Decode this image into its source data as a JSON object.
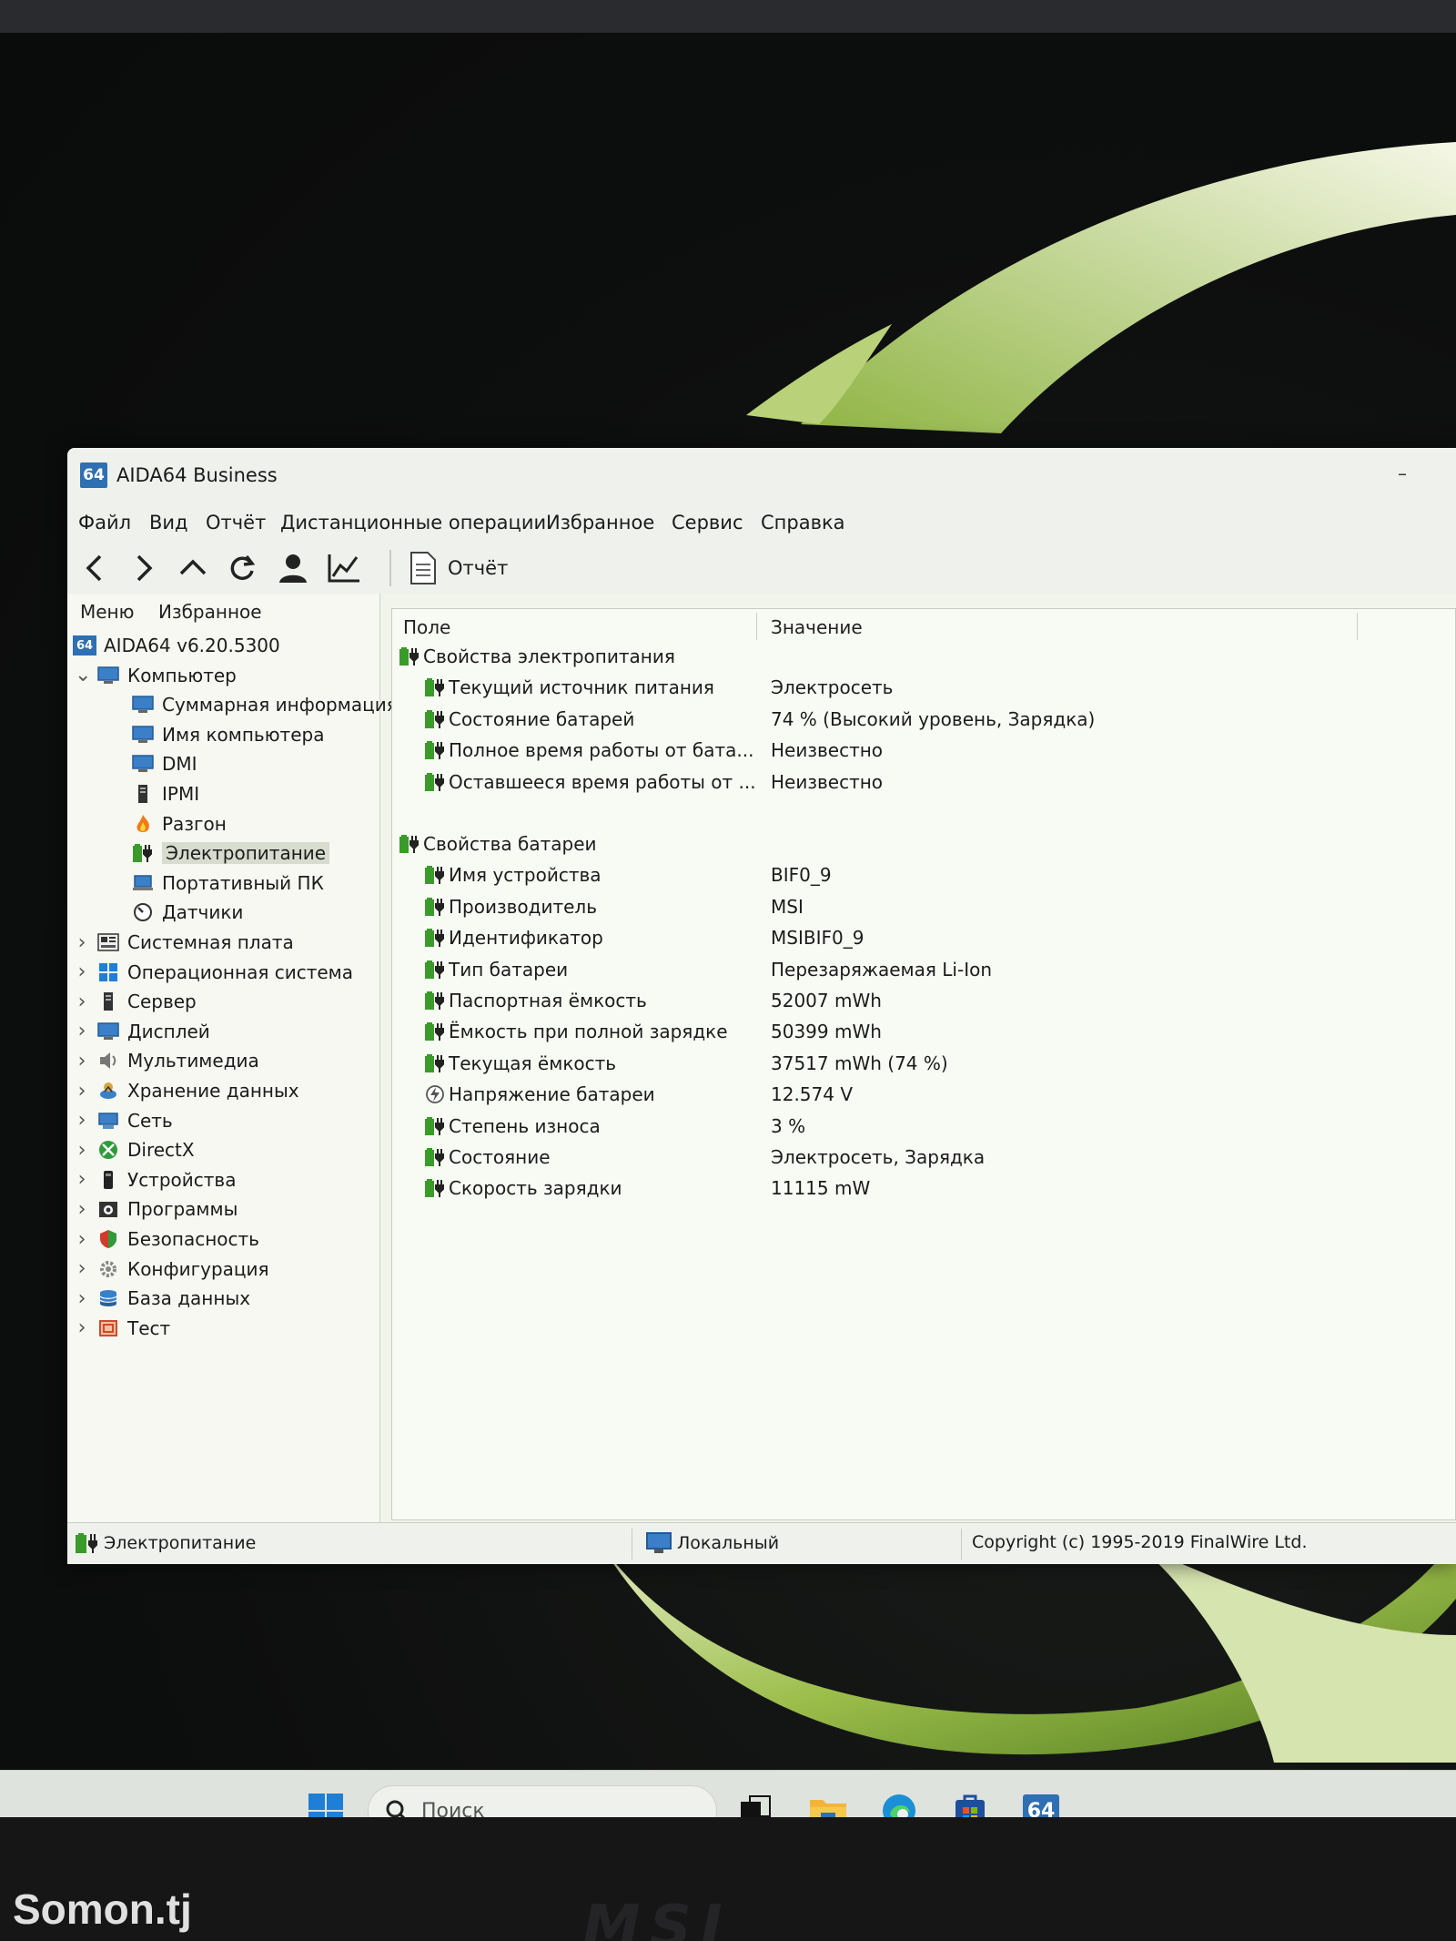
{
  "window": {
    "icon_text": "64",
    "title": "AIDA64 Business"
  },
  "menu": [
    "Файл",
    "Вид",
    "Отчёт",
    "Дистанционные операции",
    "Избранное",
    "Сервис",
    "Справка"
  ],
  "toolbar": {
    "report_label": "Отчёт"
  },
  "left_tabs": [
    "Меню",
    "Избранное"
  ],
  "tree": [
    {
      "label": "AIDA64 v6.20.5300",
      "icon": "aida64-icon"
    },
    {
      "label": "Компьютер",
      "icon": "computer-icon"
    },
    {
      "label": "Суммарная информация",
      "icon": "monitor-icon"
    },
    {
      "label": "Имя компьютера",
      "icon": "monitor-icon"
    },
    {
      "label": "DMI",
      "icon": "monitor-icon"
    },
    {
      "label": "IPMI",
      "icon": "server-icon"
    },
    {
      "label": "Разгон",
      "icon": "flame-icon"
    },
    {
      "label": "Электропитание",
      "icon": "battery-icon"
    },
    {
      "label": "Портативный ПК",
      "icon": "laptop-icon"
    },
    {
      "label": "Датчики",
      "icon": "gauge-icon"
    },
    {
      "label": "Системная плата",
      "icon": "motherboard-icon"
    },
    {
      "label": "Операционная система",
      "icon": "windows-icon"
    },
    {
      "label": "Сервер",
      "icon": "server-icon"
    },
    {
      "label": "Дисплей",
      "icon": "monitor-icon"
    },
    {
      "label": "Мультимедиа",
      "icon": "speaker-icon"
    },
    {
      "label": "Хранение данных",
      "icon": "storage-icon"
    },
    {
      "label": "Сеть",
      "icon": "network-icon"
    },
    {
      "label": "DirectX",
      "icon": "xbox-icon"
    },
    {
      "label": "Устройства",
      "icon": "device-icon"
    },
    {
      "label": "Программы",
      "icon": "programs-icon"
    },
    {
      "label": "Безопасность",
      "icon": "shield-icon"
    },
    {
      "label": "Конфигурация",
      "icon": "config-icon"
    },
    {
      "label": "База данных",
      "icon": "database-icon"
    },
    {
      "label": "Тест",
      "icon": "test-icon"
    }
  ],
  "table": {
    "col_field": "Поле",
    "col_value": "Значение",
    "rows": [
      {
        "field": "Свойства электропитания",
        "value": "",
        "group": true
      },
      {
        "field": "Текущий источник питания",
        "value": "Электросеть"
      },
      {
        "field": "Состояние батарей",
        "value": "74 % (Высокий уровень, Зарядка)"
      },
      {
        "field": "Полное время работы от бата...",
        "value": "Неизвестно"
      },
      {
        "field": "Оставшееся время работы от ...",
        "value": "Неизвестно"
      },
      {
        "field": "Свойства батареи",
        "value": "",
        "group": true
      },
      {
        "field": "Имя устройства",
        "value": "BIF0_9"
      },
      {
        "field": "Производитель",
        "value": "MSI"
      },
      {
        "field": "Идентификатор",
        "value": "MSIBIF0_9"
      },
      {
        "field": "Тип батареи",
        "value": "Перезаряжаемая Li-Ion"
      },
      {
        "field": "Паспортная ёмкость",
        "value": "52007 mWh"
      },
      {
        "field": "Ёмкость при полной зарядке",
        "value": "50399 mWh"
      },
      {
        "field": "Текущая ёмкость",
        "value": "37517 mWh  (74 %)"
      },
      {
        "field": "Напряжение батареи",
        "value": "12.574 V"
      },
      {
        "field": "Степень износа",
        "value": "3 %"
      },
      {
        "field": "Состояние",
        "value": "Электросеть, Зарядка"
      },
      {
        "field": "Скорость зарядки",
        "value": "11115 mW"
      }
    ]
  },
  "status": {
    "left": "Электропитание",
    "middle": "Локальный",
    "right": "Copyright (c) 1995-2019 FinalWire Ltd."
  },
  "taskbar": {
    "search_placeholder": "Поиск",
    "aida_icon_text": "64"
  },
  "bezel": {
    "brand": "MSI"
  },
  "watermark": "Somon.tj",
  "colors": {
    "accent": "#2f6fb3",
    "battery_green": "#3a9a2a",
    "window_bg": "#f1f4ea"
  }
}
